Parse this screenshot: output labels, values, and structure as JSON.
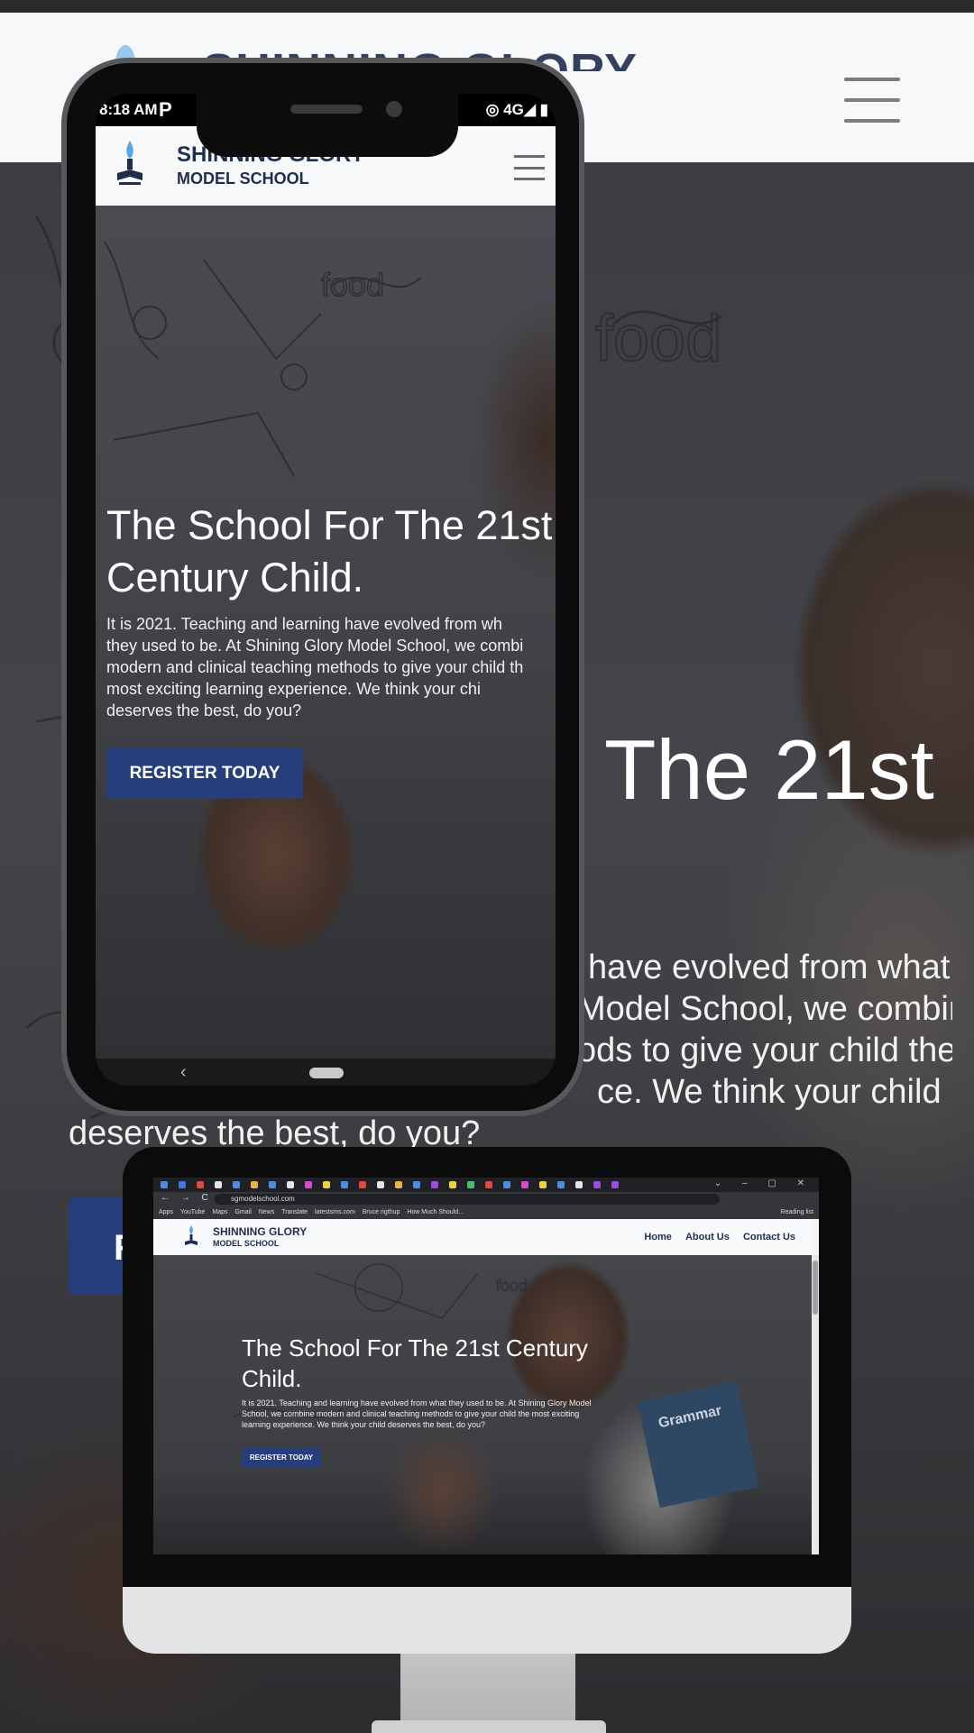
{
  "background_page": {
    "header_brand_fragment": "SHINNING GLORY",
    "hero_title_fragment": "The 21st",
    "hero_para_lines": [
      "have evolved from what",
      "Model School, we combine",
      "ods to give your child the",
      "ce. We think your child",
      "deserves the best, do you?"
    ],
    "cta_fragment": "R"
  },
  "phone": {
    "status": {
      "time": "8:18 AM",
      "app_icon": "P",
      "network": "4G",
      "right_icons": "◎ 4G◢ ▮"
    },
    "header": {
      "name_line1": "SHINNING GLORY",
      "name_line2": "MODEL SCHOOL"
    },
    "hero": {
      "title_lines": [
        "The School For The 21st",
        "Century Child."
      ],
      "para_lines": [
        "It is 2021. Teaching and learning have evolved from wh",
        "they used to be. At Shining Glory Model School, we combi",
        "modern and clinical teaching methods to give your child th",
        "most exciting learning experience. We think your chi",
        "deserves the best, do you?"
      ],
      "cta": "REGISTER TODAY"
    },
    "nav": {
      "back": "‹"
    }
  },
  "desktop": {
    "window_controls": "⌄ – ▢ ✕",
    "address": "sgmodelschool.com",
    "nav_buttons": "← → C ⌂",
    "bookmarks": [
      "Apps",
      "YouTube",
      "Maps",
      "Gmail",
      "News",
      "Translate",
      "latestsms.com",
      "Bruce rigthup",
      "How Much Should..."
    ],
    "reading_list": "Reading list",
    "header": {
      "name_line1": "SHINNING GLORY",
      "name_line2": "MODEL SCHOOL",
      "nav": [
        "Home",
        "About Us",
        "Contact Us"
      ]
    },
    "hero": {
      "title_lines": [
        "The School For The 21st Century",
        "Child."
      ],
      "para_lines": [
        "It is 2021. Teaching and learning have evolved from what they used to be. At Shining Glory Model",
        "School, we combine modern and clinical teaching methods to give your child the most exciting",
        "learning experience. We think your child deserves the best, do you?"
      ],
      "cta": "REGISTER TODAY",
      "book_text": "Grammar"
    }
  }
}
